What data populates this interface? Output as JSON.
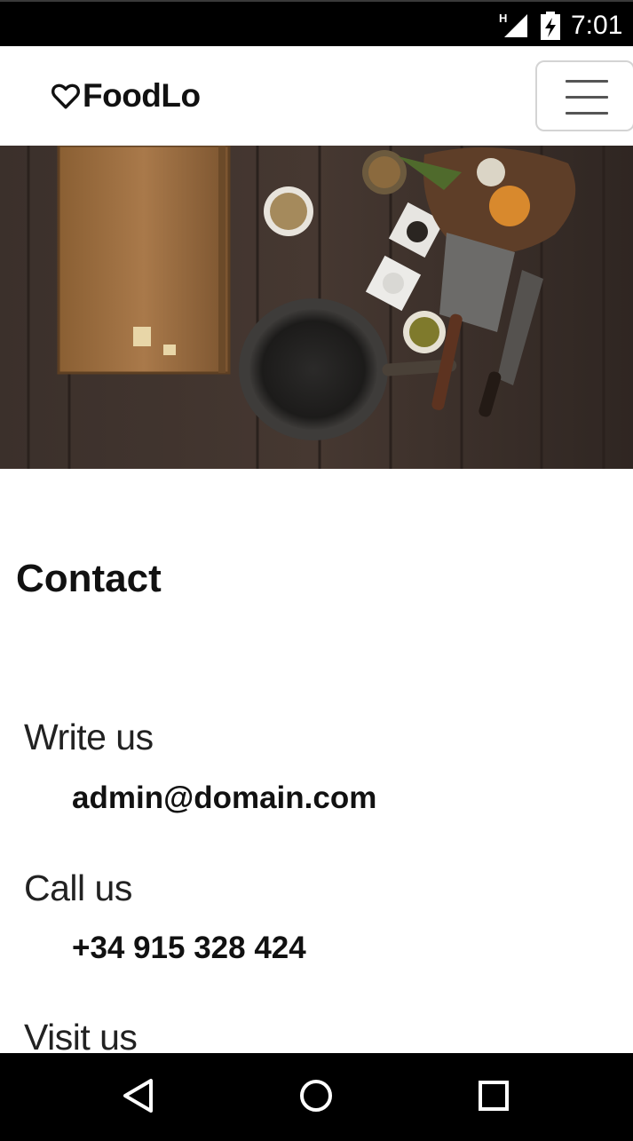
{
  "status_bar": {
    "network_type": "H",
    "time": "7:01"
  },
  "navbar": {
    "brand_name": "FoodLo",
    "brand_icon": "heart-outline-icon",
    "menu_icon": "hamburger-menu-icon"
  },
  "hero": {
    "image": "kitchen-table-photo"
  },
  "contact": {
    "title": "Contact",
    "write_label": "Write us",
    "email": "admin@domain.com",
    "call_label": "Call us",
    "phone": "+34 915 328 424",
    "visit_label": "Visit us"
  },
  "system_nav": {
    "back_icon": "back-triangle-icon",
    "home_icon": "home-circle-icon",
    "recents_icon": "recents-square-icon"
  },
  "colors": {
    "status_bar_bg": "#000000",
    "page_bg": "#ffffff",
    "text": "#111111"
  }
}
